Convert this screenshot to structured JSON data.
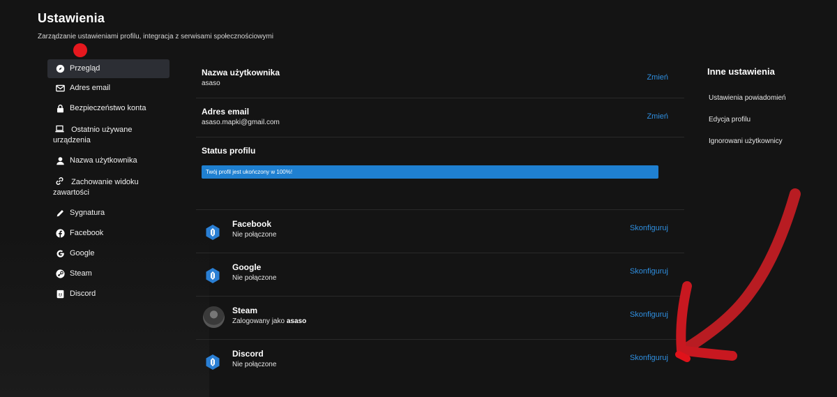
{
  "header": {
    "title": "Ustawienia",
    "subtitle": "Zarządzanie ustawieniami profilu, integracja z serwisami społecznościowymi"
  },
  "sidebar": {
    "items": [
      {
        "label": "Przegląd",
        "icon": "compass-icon"
      },
      {
        "label": "Adres email",
        "icon": "envelope-icon"
      },
      {
        "label": "Bezpieczeństwo konta",
        "icon": "lock-icon"
      },
      {
        "label": "Ostatnio używane urządzenia",
        "icon": "laptop-icon"
      },
      {
        "label": "Nazwa użytkownika",
        "icon": "user-icon"
      },
      {
        "label": "Zachowanie widoku zawartości",
        "icon": "link-icon"
      },
      {
        "label": "Sygnatura",
        "icon": "pencil-icon"
      },
      {
        "label": "Facebook",
        "icon": "facebook-icon"
      },
      {
        "label": "Google",
        "icon": "google-icon"
      },
      {
        "label": "Steam",
        "icon": "steam-icon"
      },
      {
        "label": "Discord",
        "icon": "discord-icon"
      }
    ]
  },
  "main": {
    "username": {
      "title": "Nazwa użytkownika",
      "value": "asaso",
      "action": "Zmień"
    },
    "email": {
      "title": "Adres email",
      "value": "asaso.mapki@gmail.com",
      "action": "Zmień"
    },
    "status": {
      "title": "Status profilu",
      "progress_text": "Twój profil jest ukończony w 100%!",
      "progress_percent": 100
    },
    "socials": [
      {
        "name": "Facebook",
        "status": "Nie połączone",
        "action": "Skonfiguruj"
      },
      {
        "name": "Google",
        "status": "Nie połączone",
        "action": "Skonfiguruj"
      },
      {
        "name": "Steam",
        "status_prefix": "Zalogowany jako",
        "status_user": "asaso",
        "action": "Skonfiguruj"
      },
      {
        "name": "Discord",
        "status": "Nie połączone",
        "action": "Skonfiguruj"
      }
    ]
  },
  "right": {
    "title": "Inne ustawienia",
    "items": [
      "Ustawienia powiadomień",
      "Edycja profilu",
      "Ignorowani użytkownicy"
    ]
  },
  "colors": {
    "background": "#141414",
    "accent": "#2f8fe0",
    "progress": "#1f80d1",
    "annotation": "#c81820"
  }
}
